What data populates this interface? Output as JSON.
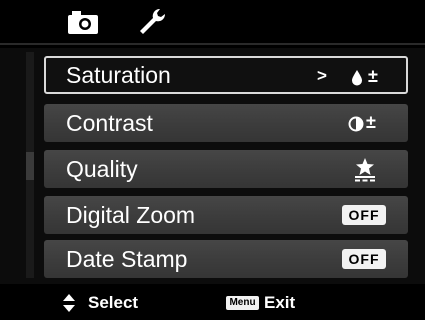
{
  "tabs": [
    {
      "icon": "camera-icon",
      "active": false
    },
    {
      "icon": "wrench-icon",
      "active": true
    }
  ],
  "menu": {
    "items": [
      {
        "label": "Saturation",
        "arrow": ">",
        "value_icon": "saturation-icon",
        "value_text": "±",
        "selected": true
      },
      {
        "label": "Contrast",
        "value_icon": "contrast-icon",
        "value_text": "±"
      },
      {
        "label": "Quality",
        "value_icon": "quality-stars-icon"
      },
      {
        "label": "Digital Zoom",
        "value": "OFF"
      },
      {
        "label": "Date Stamp",
        "value": "OFF"
      }
    ]
  },
  "footer": {
    "select_label": "Select",
    "menu_badge": "Menu",
    "exit_label": "Exit"
  },
  "colors": {
    "background": "#000000",
    "row": "#3f3f3f",
    "selection_border": "#d9d9d9"
  }
}
